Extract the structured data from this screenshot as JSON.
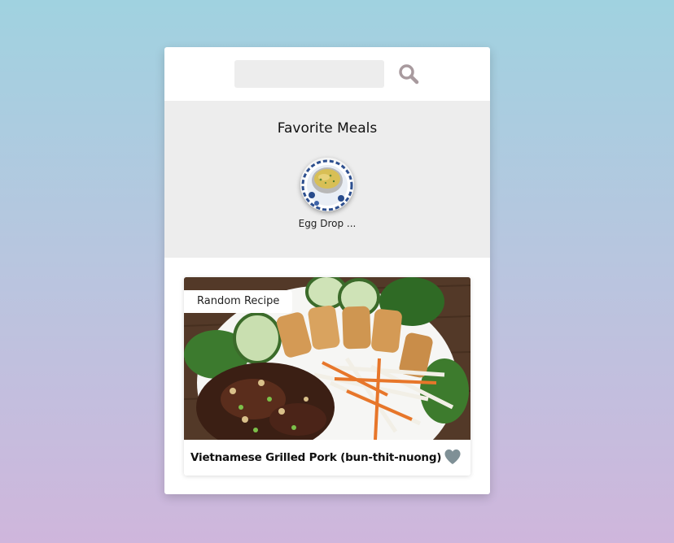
{
  "search": {
    "placeholder": "",
    "value": "",
    "icon": "search-icon"
  },
  "favorites": {
    "title": "Favorite Meals",
    "items": [
      {
        "name": "Egg Drop ..."
      }
    ]
  },
  "meal": {
    "badge": "Random Recipe",
    "name": "Vietnamese Grilled Pork (bun-thit-nuong)",
    "favorite_icon": "heart-icon"
  },
  "colors": {
    "accent": "#a89a9e",
    "heart": "#7f9096",
    "panel": "#ededed"
  }
}
